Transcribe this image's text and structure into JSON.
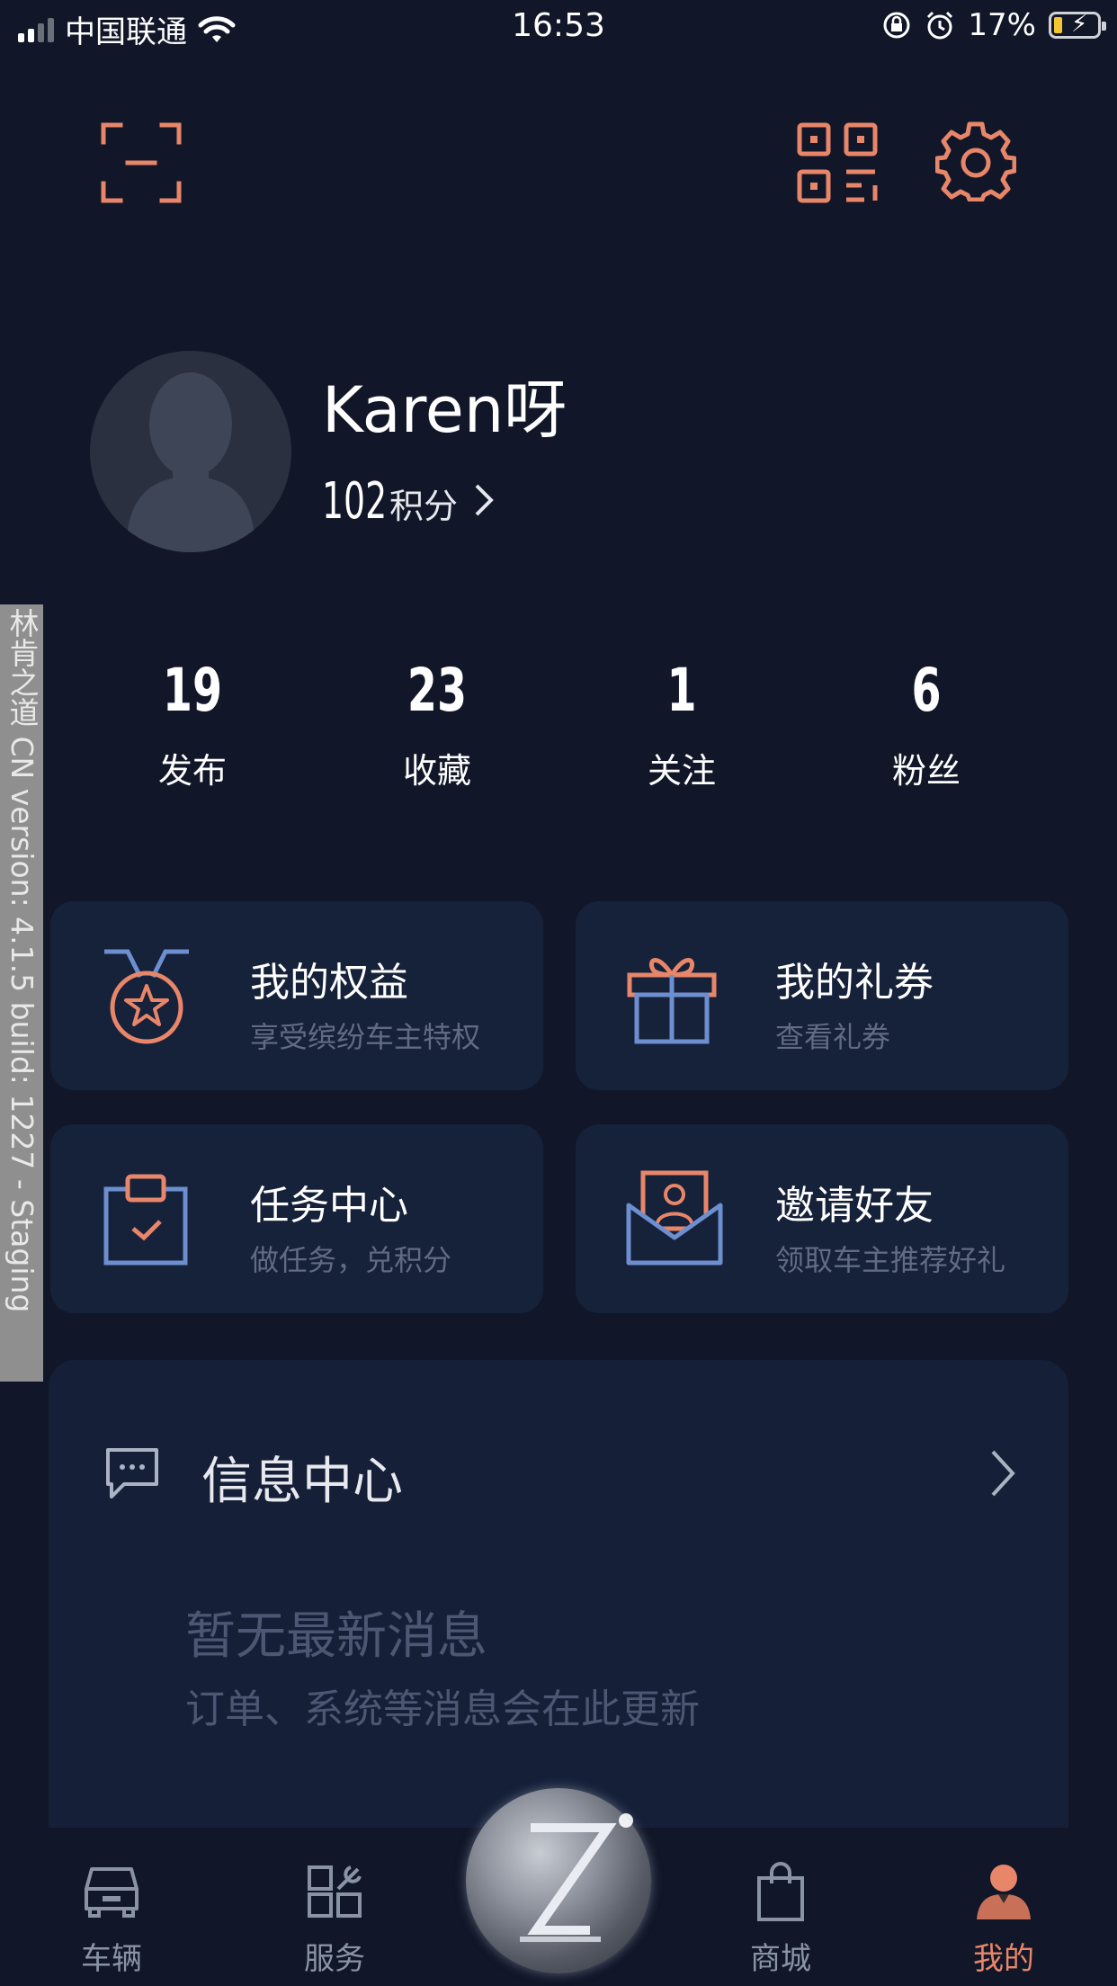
{
  "status_bar": {
    "carrier": "中国联通",
    "time": "16:53",
    "battery": "17%"
  },
  "header": {
    "scan_icon": "scan-icon",
    "qrcode_icon": "qrcode-icon",
    "settings_icon": "gear-icon"
  },
  "profile": {
    "username": "Karen呀",
    "points_value": "102",
    "points_label": "积分"
  },
  "stats": [
    {
      "value": "19",
      "label": "发布"
    },
    {
      "value": "23",
      "label": "收藏"
    },
    {
      "value": "1",
      "label": "关注"
    },
    {
      "value": "6",
      "label": "粉丝"
    }
  ],
  "cards": [
    {
      "title": "我的权益",
      "subtitle": "享受缤纷车主特权",
      "icon": "medal-icon"
    },
    {
      "title": "我的礼券",
      "subtitle": "查看礼券",
      "icon": "gift-icon"
    },
    {
      "title": "任务中心",
      "subtitle": "做任务，兑积分",
      "icon": "task-clipboard-icon"
    },
    {
      "title": "邀请好友",
      "subtitle": "领取车主推荐好礼",
      "icon": "invite-envelope-icon"
    }
  ],
  "info_center": {
    "title": "信息中心",
    "empty_title": "暂无最新消息",
    "empty_desc": "订单、系统等消息会在此更新"
  },
  "tabs": [
    {
      "label": "车辆"
    },
    {
      "label": "服务"
    },
    {
      "label": "商城"
    },
    {
      "label": "我的"
    }
  ],
  "watermark": "林肯之道 CN version: 4.1.5 build: 1227 - Staging",
  "colors": {
    "background": "#111728",
    "card": "#16213a",
    "accent_orange": "#e8866a",
    "accent_blue": "#6d8fd0"
  }
}
